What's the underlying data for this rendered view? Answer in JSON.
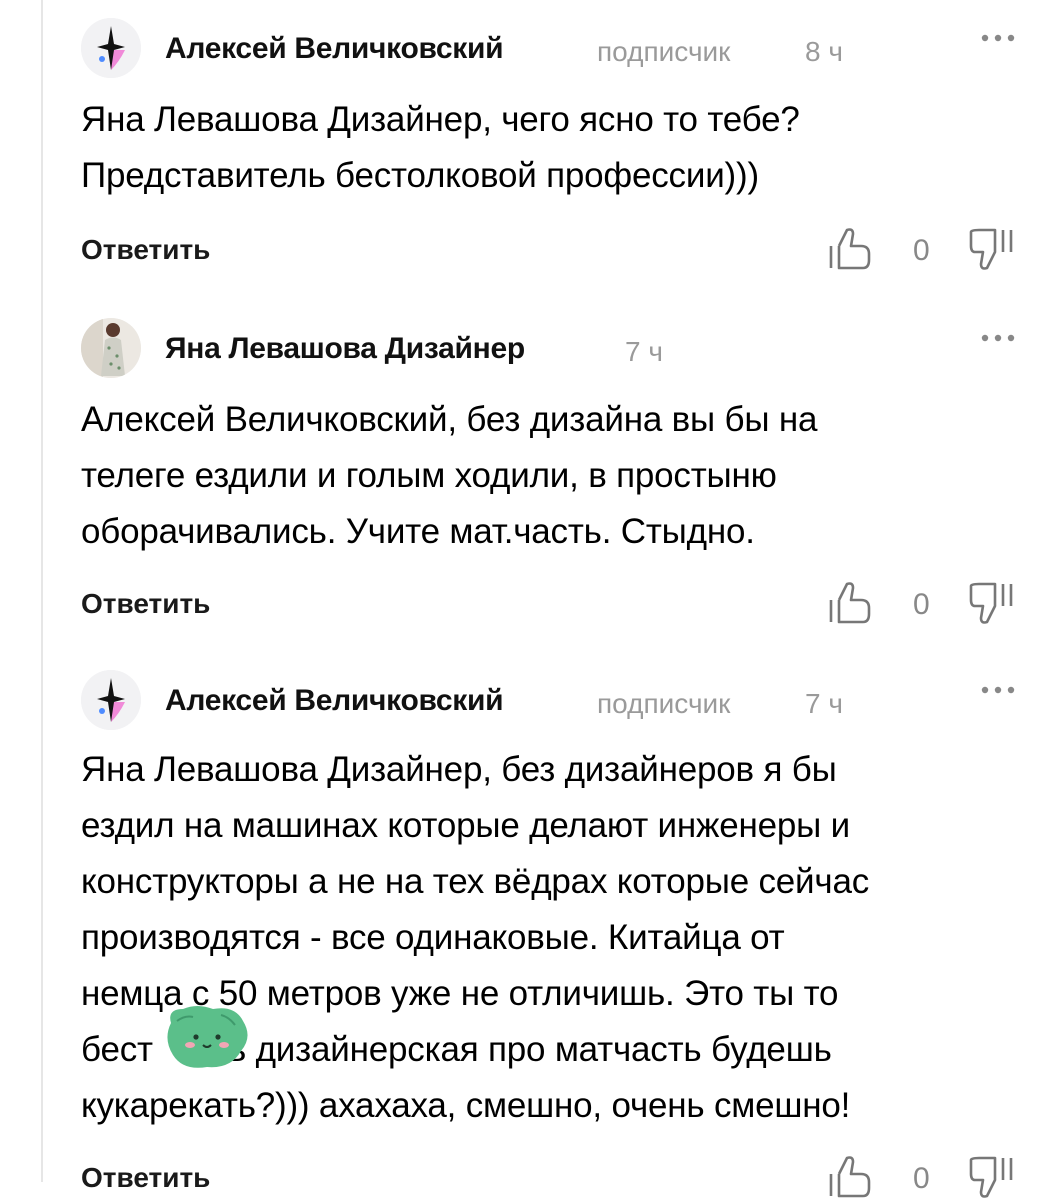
{
  "comments": [
    {
      "author": "Алексей Величковский",
      "badge": "подписчик",
      "time": "8 ч",
      "avatar": "brand-star-icon",
      "lines": [
        "Яна Левашова Дизайнер, чего ясно то тебе?",
        "Представитель бестолковой профессии)))"
      ],
      "reply_label": "Ответить",
      "likes": "0"
    },
    {
      "author": "Яна Левашова Дизайнер",
      "badge": "",
      "time": "7 ч",
      "avatar": "user-photo",
      "lines": [
        "Алексей Величковский, без дизайна вы бы на",
        "телеге ездили и голым ходили, в простыню",
        "оборачивались. Учите мат.часть. Стыдно."
      ],
      "reply_label": "Ответить",
      "likes": "0"
    },
    {
      "author": "Алексей Величковский",
      "badge": "подписчик",
      "time": "7 ч",
      "avatar": "brand-star-icon",
      "lines": [
        "Яна Левашова Дизайнер, без дизайнеров я бы",
        "ездил на машинах которые делают инженеры и",
        "конструкторы а не на тех вёдрах которые сейчас",
        "производятся - все одинаковые. Китайца от",
        "немца с 50 метров уже не отличишь. Это ты то",
        "бест      чь дизайнерская про матчасть будешь",
        "кукарекать?))) ахахаха, смешно, очень смешно!"
      ],
      "reply_label": "Ответить",
      "likes": "0"
    }
  ],
  "colors": {
    "brand_star_dark": "#111111",
    "brand_star_pink": "#f08ad8",
    "brand_star_blue": "#4f8cff",
    "sticker_green": "#5bbf8a",
    "meta_gray": "#9a9a9a"
  }
}
